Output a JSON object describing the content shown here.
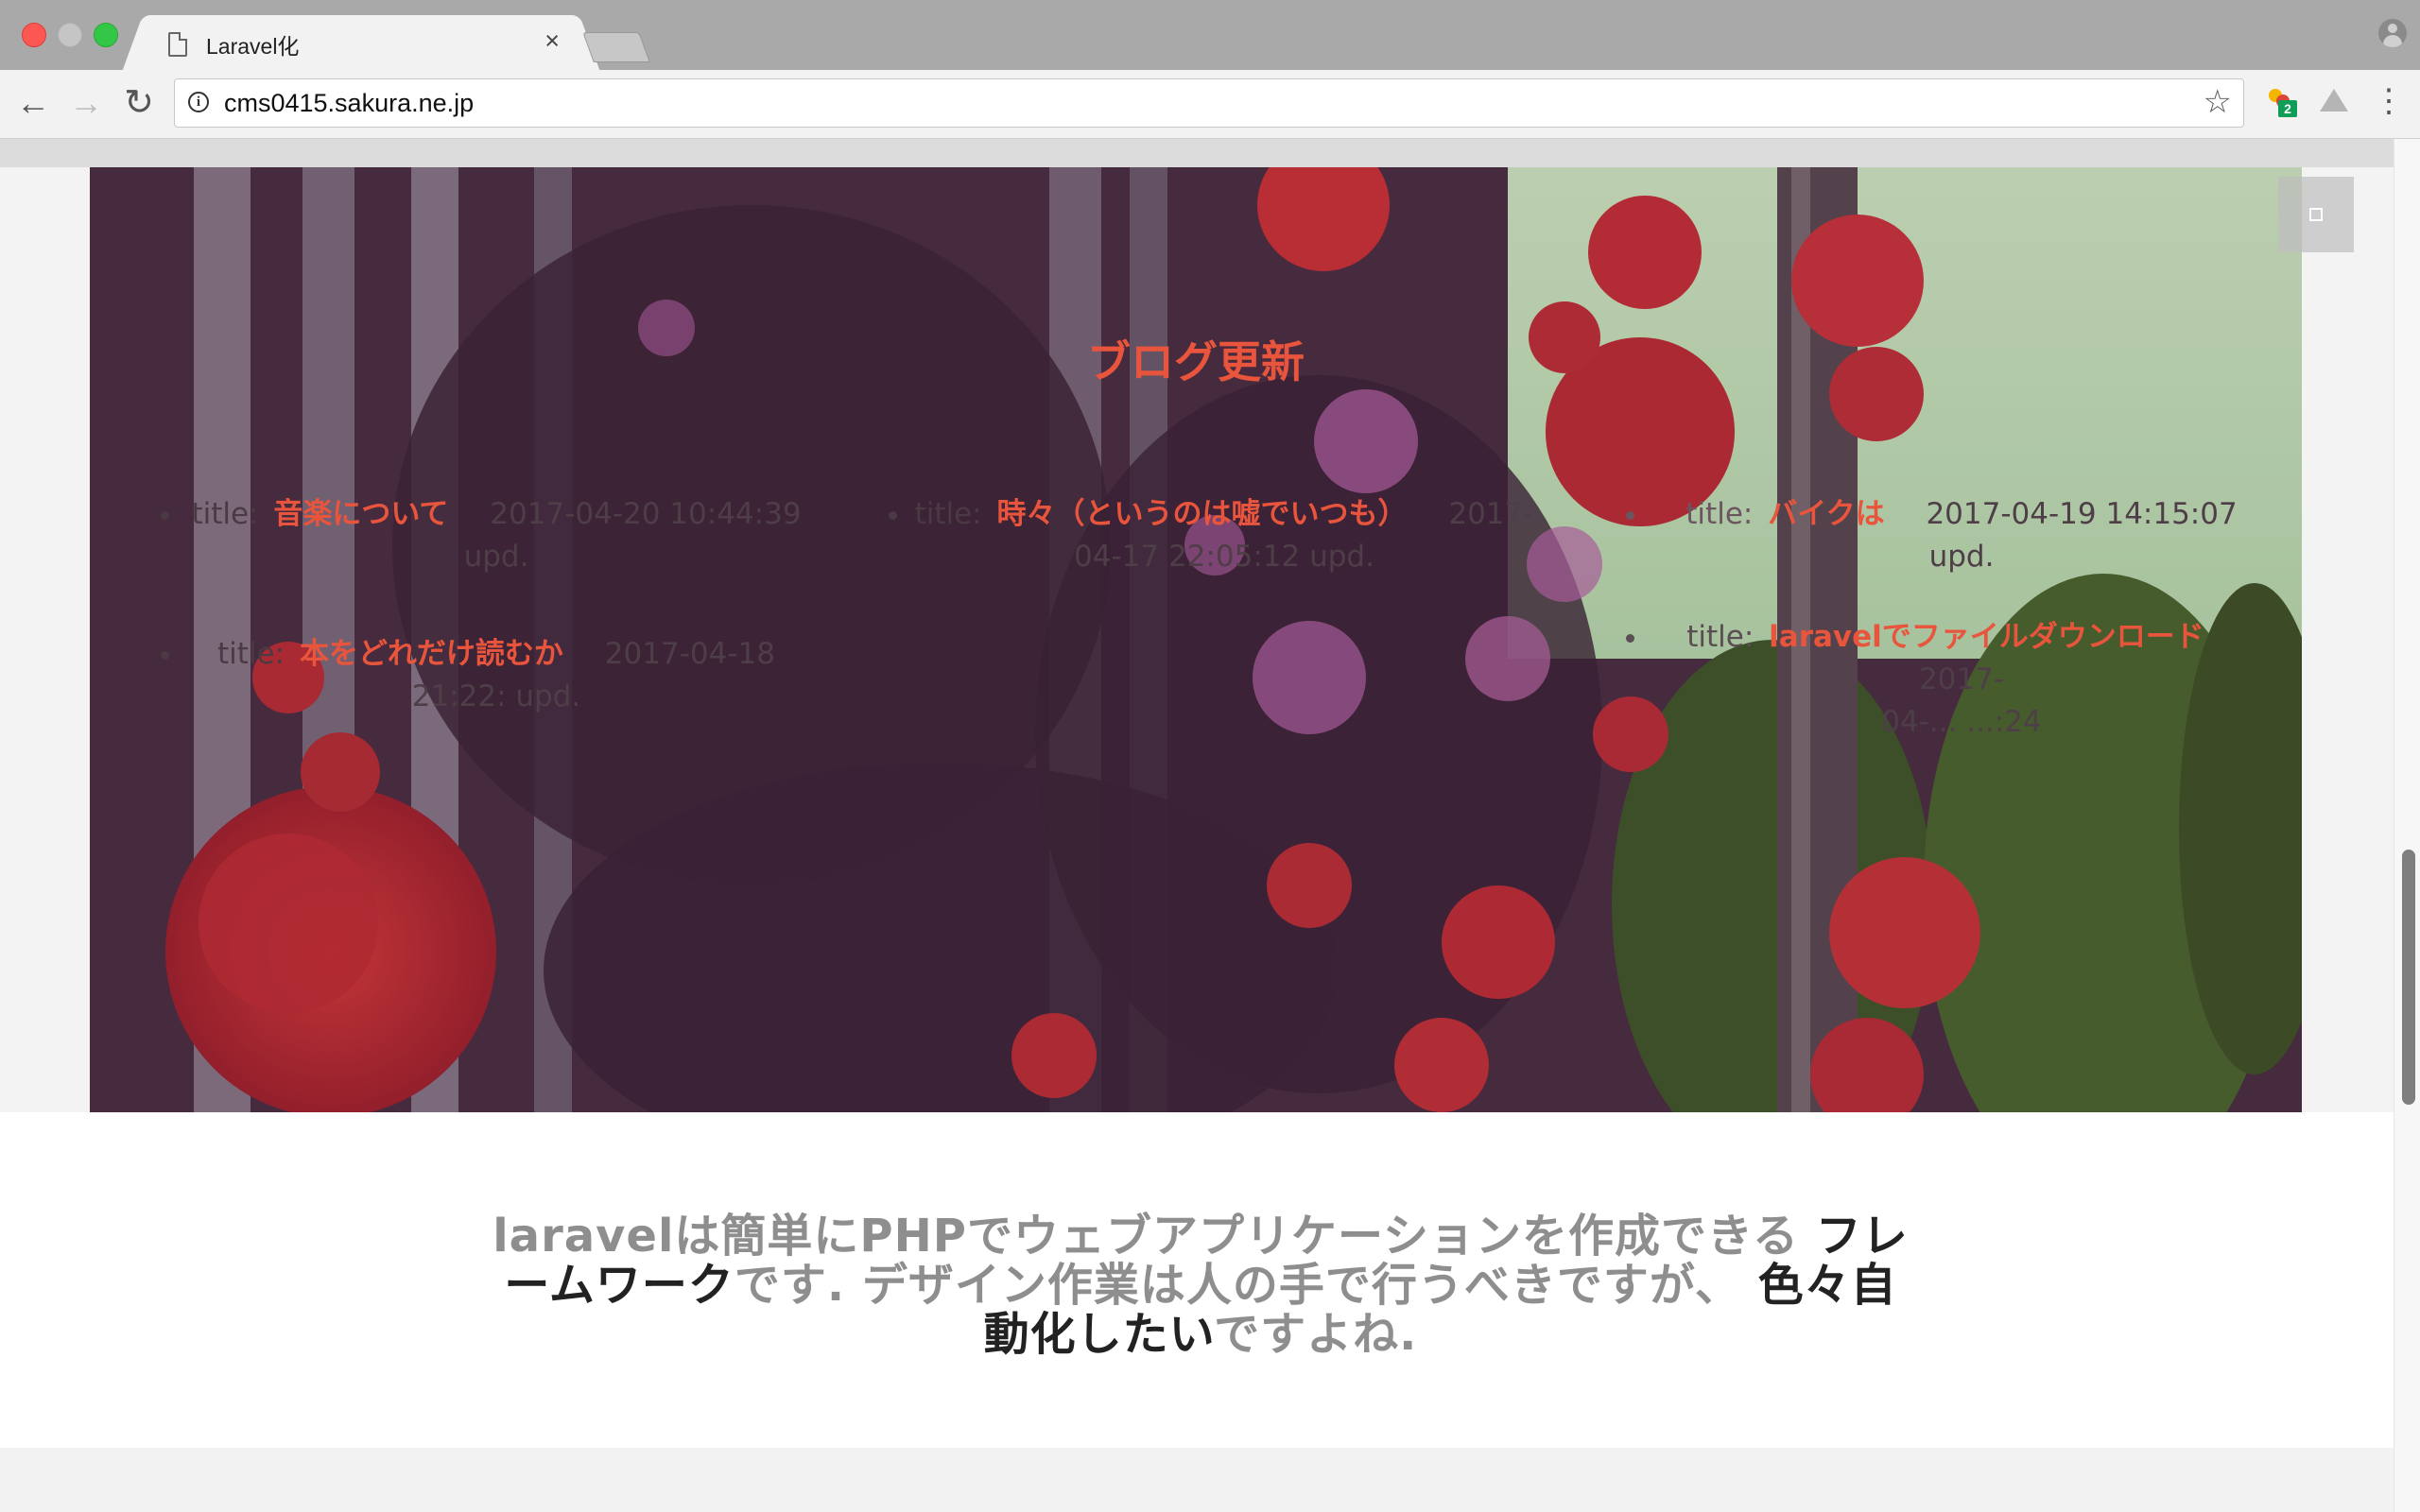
{
  "browser": {
    "tab_title": "Laravel化",
    "tab_close": "×",
    "url": "cms0415.sakura.ne.jp",
    "info_glyph": "i",
    "back_glyph": "←",
    "forward_glyph": "→",
    "reload_glyph": "↻",
    "star_glyph": "☆",
    "menu_glyph": "⋮",
    "extension_badge": "2",
    "icons": [
      "document-icon",
      "info-icon",
      "star-icon",
      "extension-icon",
      "drive-icon",
      "menu-icon",
      "profile-icon"
    ]
  },
  "hero": {
    "heading": "ブログ更新",
    "label_title": "title:",
    "label_upd": "upd.",
    "posts": [
      {
        "title": "音楽について",
        "date_a": "2017-04-20 10:44:39",
        "date_b": ""
      },
      {
        "title": "本をどれだけ読むか",
        "date_a": "2017-04-18",
        "date_b": "21:22:"
      },
      {
        "title": "時々（というのは嘘でいつも）",
        "date_a": "2017-",
        "date_b": "04-17 22:05:12"
      },
      {
        "title": "バイクは",
        "date_a": "2017-04-19 14:15:07",
        "date_b": ""
      },
      {
        "title": "laravelでファイルダウンロード",
        "date_a": "2017-",
        "date_b": "04-... ...:24"
      }
    ]
  },
  "about": {
    "part1": "laravelは簡単にPHPでウェブアプリケーションを作成できる ",
    "em1": "フレームワーク",
    "part2": "です. デザイン作業は人の手で行うべきですが、 ",
    "em2": "色々自動化したい",
    "part3": "ですよね."
  },
  "colors": {
    "accent": "#e8553c",
    "hero_overlay": "#4e2f43",
    "about_text": "#8e8e8e"
  }
}
